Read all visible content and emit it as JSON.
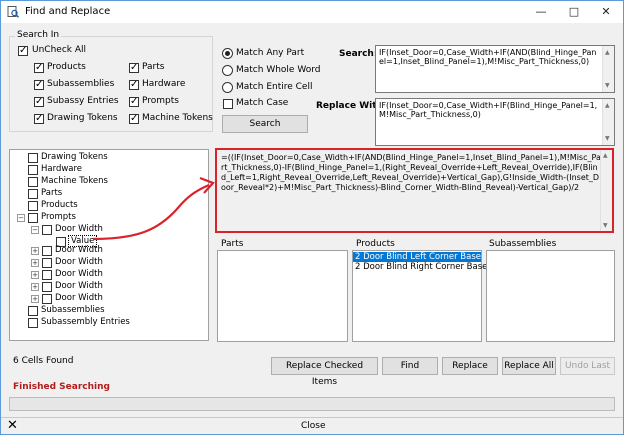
{
  "window": {
    "title": "Find and Replace"
  },
  "search_in": {
    "label": "Search In",
    "uncheck_all": "UnCheck All",
    "items": [
      {
        "label": "Products",
        "checked": true
      },
      {
        "label": "Parts",
        "checked": true
      },
      {
        "label": "Subassemblies",
        "checked": true
      },
      {
        "label": "Hardware",
        "checked": true
      },
      {
        "label": "Subassy Entries",
        "checked": true
      },
      {
        "label": "Prompts",
        "checked": true
      },
      {
        "label": "Drawing Tokens",
        "checked": true
      },
      {
        "label": "Machine Tokens",
        "checked": true
      }
    ]
  },
  "match": {
    "any_part": "Match Any Part",
    "whole_word": "Match Whole Word",
    "entire_cell": "Match Entire Cell",
    "match_case": "Match Case",
    "search_button": "Search"
  },
  "search": {
    "label": "Search:",
    "value": "IF(Inset_Door=0,Case_Width+IF(AND(Blind_Hinge_Panel=1,Inset_Blind_Panel=1),M!Misc_Part_Thickness,0)"
  },
  "replace": {
    "label": "Replace With:",
    "value": "IF(Inset_Door=0,Case_Width+IF(Blind_Hinge_Panel=1,M!Misc_Part_Thickness,0)"
  },
  "tree": {
    "items": [
      "Drawing Tokens",
      "Hardware",
      "Machine Tokens",
      "Parts",
      "Products",
      "Prompts",
      "Door Width",
      "Value",
      "Door Width",
      "Door Width",
      "Door Width",
      "Door Width",
      "Door Width",
      "Subassemblies",
      "Subassembly Entries"
    ]
  },
  "formula": {
    "value": "=((IF(Inset_Door=0,Case_Width+IF(AND(Blind_Hinge_Panel=1,Inset_Blind_Panel=1),M!Misc_Part_Thickness,0)-IF(Blind_Hinge_Panel=1,(Right_Reveal_Override+Left_Reveal_Override),IF(Blind_Left=1,Right_Reveal_Override,Left_Reveal_Override)+Vertical_Gap),G!Inside_Width-(Inset_Door_Reveal*2)+M!Misc_Part_Thickness)-Blind_Corner_Width-Blind_Reveal)-Vertical_Gap)/2"
  },
  "lists": {
    "parts_label": "Parts",
    "products_label": "Products",
    "subassemblies_label": "Subassemblies",
    "products": [
      "2 Door Blind Left Corner Base",
      "2 Door Blind Right Corner Base"
    ]
  },
  "status": {
    "cells_found": "6 Cells Found",
    "finished": "Finished Searching",
    "finished_color": "#b01c1c"
  },
  "buttons": {
    "replace_checked": "Replace Checked Items",
    "find": "Find",
    "replace": "Replace",
    "replace_all": "Replace All",
    "undo_last": "Undo Last",
    "close": "Close"
  }
}
